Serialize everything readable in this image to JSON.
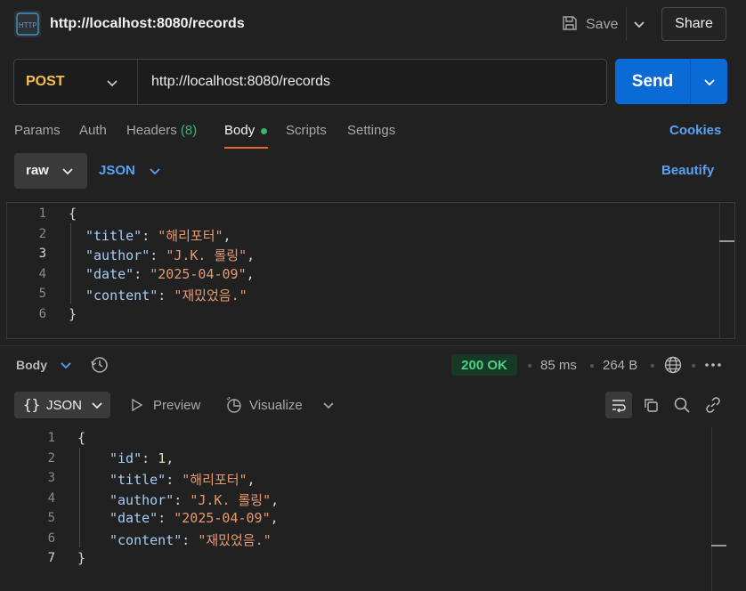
{
  "header": {
    "title": "http://localhost:8080/records",
    "icon_text": "HTTP",
    "save_label": "Save",
    "share_label": "Share"
  },
  "request": {
    "method": "POST",
    "url": "http://localhost:8080/records",
    "send_label": "Send"
  },
  "tabs": [
    {
      "label": "Params"
    },
    {
      "label": "Auth"
    },
    {
      "label": "Headers",
      "count": "(8)"
    },
    {
      "label": "Body"
    },
    {
      "label": "Scripts"
    },
    {
      "label": "Settings"
    }
  ],
  "cookies_label": "Cookies",
  "body_controls": {
    "mode": "raw",
    "format": "JSON",
    "beautify_label": "Beautify"
  },
  "request_body": {
    "line_numbers": [
      "1",
      "2",
      "3",
      "4",
      "5",
      "6"
    ],
    "open": "{",
    "close": "}",
    "fields": [
      {
        "key": "\"title\"",
        "value": "\"해리포터\"",
        "sep": ": ",
        "tail": ","
      },
      {
        "key": "\"author\"",
        "value": "\"J.K. 롤링\"",
        "sep": ": ",
        "tail": ","
      },
      {
        "key": "\"date\"",
        "value": "\"2025-04-09\"",
        "sep": ": ",
        "tail": ","
      },
      {
        "key": "\"content\"",
        "value": "\"재밌었음.\"",
        "sep": ": ",
        "tail": ""
      }
    ]
  },
  "response": {
    "body_label": "Body",
    "status": "200 OK",
    "time": "85 ms",
    "size": "264 B",
    "format": "JSON",
    "preview_label": "Preview",
    "visualize_label": "Visualize",
    "line_numbers": [
      "1",
      "2",
      "3",
      "4",
      "5",
      "6",
      "7"
    ],
    "open": "{",
    "close": "}",
    "fields": [
      {
        "key": "\"id\"",
        "value": "1",
        "sep": ": ",
        "tail": ","
      },
      {
        "key": "\"title\"",
        "value": "\"해리포터\"",
        "sep": ": ",
        "tail": ","
      },
      {
        "key": "\"author\"",
        "value": "\"J.K. 롤링\"",
        "sep": ": ",
        "tail": ","
      },
      {
        "key": "\"date\"",
        "value": "\"2025-04-09\"",
        "sep": ": ",
        "tail": ","
      },
      {
        "key": "\"content\"",
        "value": "\"재밌었음.\"",
        "sep": ": ",
        "tail": ""
      }
    ]
  },
  "colors": {
    "accent": "#0a6bd6",
    "method": "#f5c04a",
    "status_ok": "#4ccf82",
    "tab_underline": "#e2673a"
  }
}
